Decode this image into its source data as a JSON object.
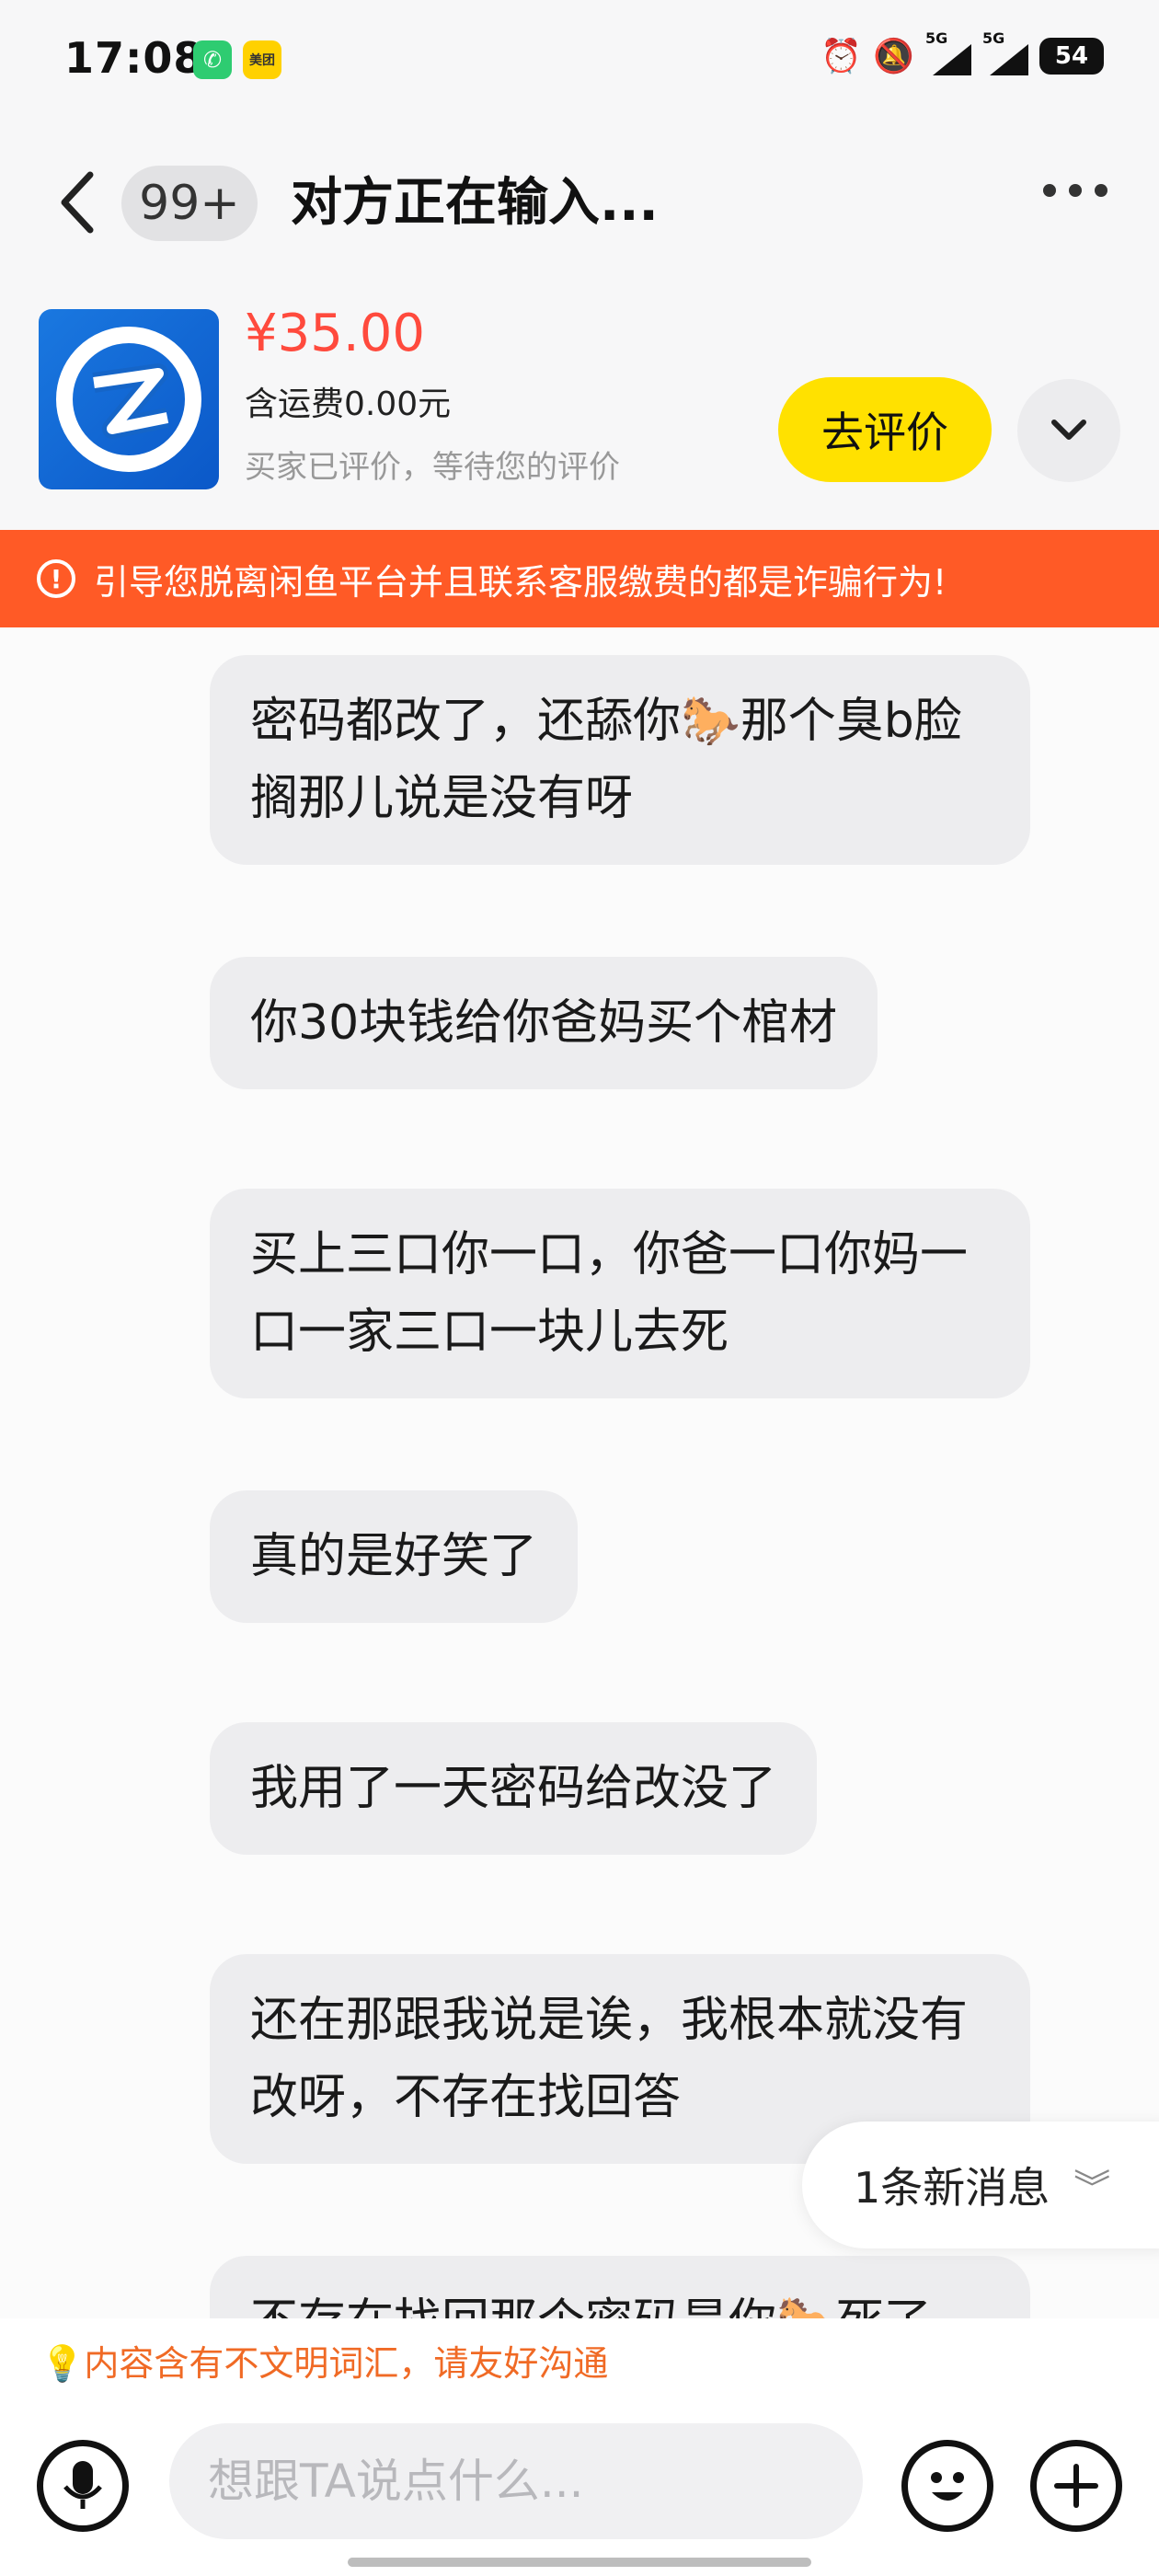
{
  "status_bar": {
    "time": "17:08",
    "meituan_label": "美团",
    "signal1": "5G",
    "signal2": "5G",
    "battery": "54"
  },
  "header": {
    "unread_count": "99+",
    "title": "对方正在输入..."
  },
  "product": {
    "price": "¥35.00",
    "shipping": "含运费0.00元",
    "note": "买家已评价，等待您的评价",
    "review_button": "去评价"
  },
  "warning": {
    "text": "引导您脱离闲鱼平台并且联系客服缴费的都是诈骗行为!"
  },
  "messages": [
    {
      "text": "密码都改了，还舔你🐎那个臭b脸搁那儿说是没有呀"
    },
    {
      "text": "你30块钱给你爸妈买个棺材"
    },
    {
      "text": "买上三口你一口，你爸一口你妈一口一家三口一块儿去死"
    },
    {
      "text": "真的是好笑了"
    },
    {
      "text": "我用了一天密码给改没了"
    },
    {
      "text": "还在那跟我说是诶，我根本就没有改呀，不存在找回答"
    },
    {
      "text": "不存在找回那个密码是你🐎死了"
    }
  ],
  "new_message_pill": "1条新消息",
  "civility_hint": "💡内容含有不文明词汇，请友好沟通",
  "input": {
    "placeholder": "想跟TA说点什么..."
  },
  "colors": {
    "price": "#ff4a3d",
    "review_button": "#ffe100",
    "warning_banner": "#ff5a26",
    "civility_hint": "#f06a25"
  }
}
